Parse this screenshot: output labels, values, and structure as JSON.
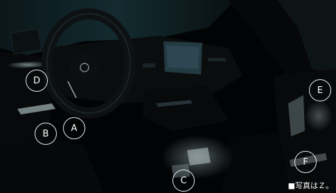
{
  "photo": {
    "subject": "car-interior-ambient-lighting",
    "palette": {
      "background": "#020304",
      "ambient_glow": "#b9dcdf",
      "trim": "#dfe6e8",
      "dash_screen": "#2f4a55",
      "pedal_light": "#9fb3b8"
    }
  },
  "markers": {
    "A": "A",
    "B": "B",
    "C": "C",
    "D": "D",
    "E": "E",
    "F": "F"
  },
  "caption": "■写真はＺ。"
}
